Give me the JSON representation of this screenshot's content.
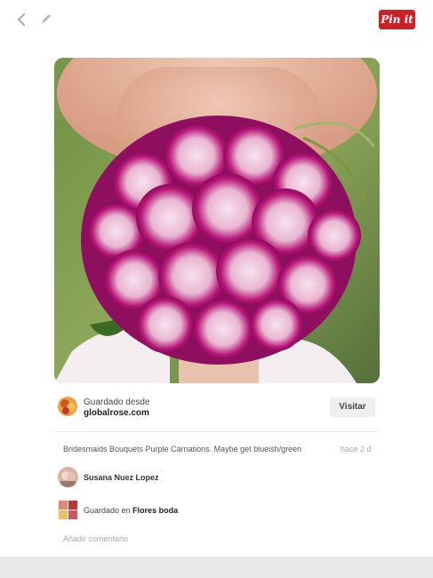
{
  "toolbar": {
    "pinit_label": "Pin it"
  },
  "pin": {
    "source_prefix": "Guardado desde",
    "source_domain": "globalrose.com",
    "visit_label": "Visitar",
    "description": "Bridesmaids Bouquets Purple Carnations. Maybe get blueish/green",
    "time": "hace 2 d"
  },
  "user": {
    "name": "Susana Nuez Lopez"
  },
  "board": {
    "prefix": "Guardado en",
    "name": "Flores boda"
  },
  "comment": {
    "placeholder": "Añadir comentario"
  },
  "bottom": {
    "label": ""
  },
  "colors": {
    "pinit": "#cb2027",
    "flower_magenta": "#b0126f",
    "flower_light": "#f4d6e6"
  },
  "icons": [
    "back-chevron-icon",
    "pencil-icon"
  ]
}
